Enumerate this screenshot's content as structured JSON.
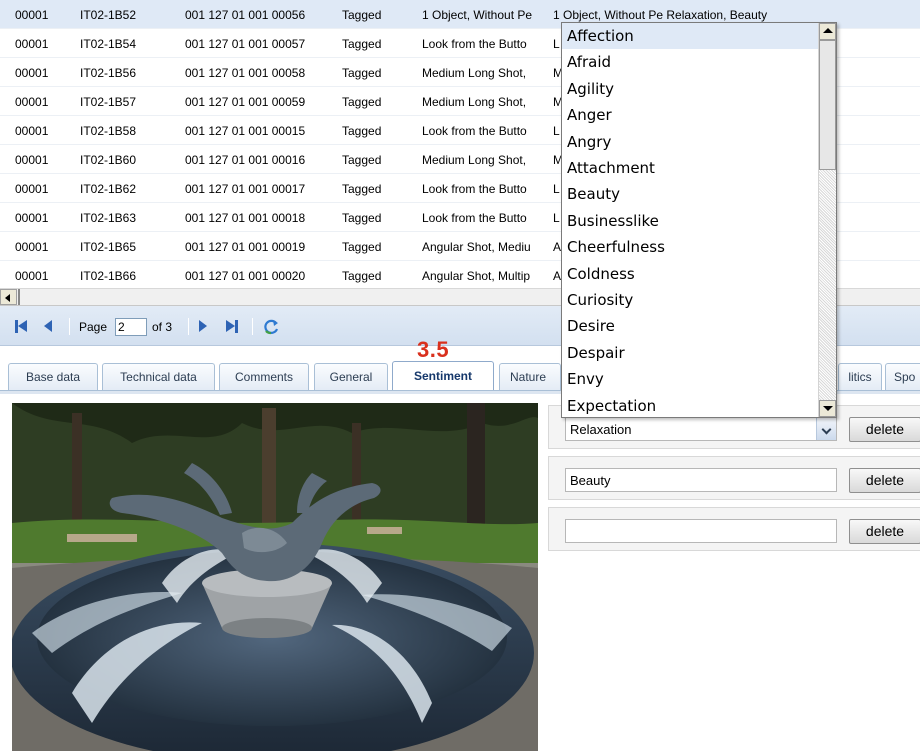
{
  "grid": {
    "rows": [
      {
        "c1": "00001",
        "c2": "IT02-1B52",
        "c3": "001 127 01 001 00056",
        "c4": "Tagged",
        "c5": "1 Object, Without Pe",
        "c6": "1 Object, Without Pe Relaxation, Beauty"
      },
      {
        "c1": "00001",
        "c2": "IT02-1B54",
        "c3": "001 127 01 001 00057",
        "c4": "Tagged",
        "c5": "Look from the Butto",
        "c6": "L"
      },
      {
        "c1": "00001",
        "c2": "IT02-1B56",
        "c3": "001 127 01 001 00058",
        "c4": "Tagged",
        "c5": "Medium Long Shot,",
        "c6": "M"
      },
      {
        "c1": "00001",
        "c2": "IT02-1B57",
        "c3": "001 127 01 001 00059",
        "c4": "Tagged",
        "c5": "Medium Long Shot,",
        "c6": "M"
      },
      {
        "c1": "00001",
        "c2": "IT02-1B58",
        "c3": "001 127 01 001 00015",
        "c4": "Tagged",
        "c5": "Look from the Butto",
        "c6": "L                                                    ather:Blue Sk"
      },
      {
        "c1": "00001",
        "c2": "IT02-1B60",
        "c3": "001 127 01 001 00016",
        "c4": "Tagged",
        "c5": "Medium Long Shot,",
        "c6": "M"
      },
      {
        "c1": "00001",
        "c2": "IT02-1B62",
        "c3": "001 127 01 001 00017",
        "c4": "Tagged",
        "c5": "Look from the Butto",
        "c6": "L                                                    ather:Blue Sk"
      },
      {
        "c1": "00001",
        "c2": "IT02-1B63",
        "c3": "001 127 01 001 00018",
        "c4": "Tagged",
        "c5": "Look from the Butto",
        "c6": "L                                                    ather:Blue Sk"
      },
      {
        "c1": "00001",
        "c2": "IT02-1B65",
        "c3": "001 127 01 001 00019",
        "c4": "Tagged",
        "c5": "Angular Shot, Mediu",
        "c6": "A                                                    ather:Blue Sk"
      },
      {
        "c1": "00001",
        "c2": "IT02-1B66",
        "c3": "001 127 01 001 00020",
        "c4": "Tagged",
        "c5": "Angular Shot, Multip",
        "c6": "A                                                    ather:Blue Sk"
      }
    ]
  },
  "pager": {
    "page_label": "Page",
    "page_value": "2",
    "of_label": "of 3"
  },
  "tabs": {
    "badge": "3.5",
    "items": [
      {
        "label": "Base data"
      },
      {
        "label": "Technical data"
      },
      {
        "label": "Comments"
      },
      {
        "label": "General"
      },
      {
        "label": "Sentiment"
      },
      {
        "label": "Nature"
      },
      {
        "label": "litics"
      },
      {
        "label": "Spo"
      }
    ]
  },
  "editor": {
    "rows": [
      {
        "value": "Relaxation",
        "delete_label": "delete"
      },
      {
        "value": "Beauty",
        "delete_label": "delete"
      },
      {
        "value": "",
        "delete_label": "delete"
      }
    ]
  },
  "dropdown": {
    "options": [
      "Affection",
      "Afraid",
      "Agility",
      "Anger",
      "Angry",
      "Attachment",
      "Beauty",
      "Businesslike",
      "Cheerfulness",
      "Coldness",
      "Curiosity",
      "Desire",
      "Despair",
      "Envy",
      "Expectation"
    ]
  },
  "colors": {
    "selected_row": "#dfe9f6",
    "badge": "#d9301d",
    "pager_icon": "#2e63b4"
  }
}
